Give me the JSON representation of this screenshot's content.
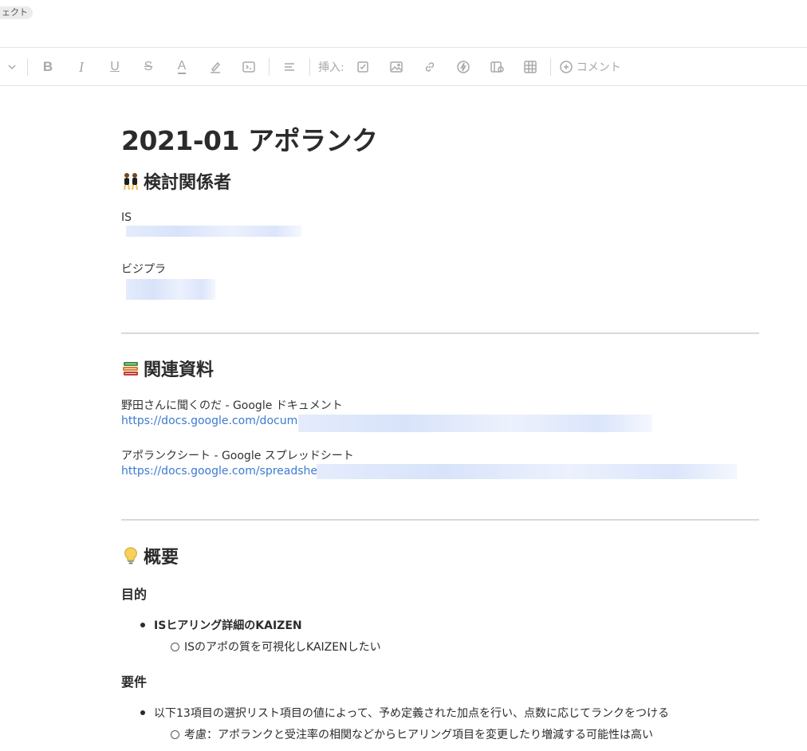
{
  "header": {
    "tag_label": "ェクト"
  },
  "toolbar": {
    "bold": "B",
    "italic": "I",
    "underline": "U",
    "strike": "S",
    "text_color": "A",
    "insert_label": "挿入:",
    "comment_label": "コメント",
    "icons": [
      "chevron-down-icon",
      "bold-icon",
      "italic-icon",
      "underline-icon",
      "strikethrough-icon",
      "text-color-icon",
      "highlight-icon",
      "code-icon",
      "align-icon",
      "checkbox-icon",
      "image-icon",
      "link-icon",
      "lightning-icon",
      "embed-icon",
      "table-icon",
      "add-comment-icon"
    ]
  },
  "doc": {
    "title": "2021-01 アポランク",
    "stakeholders": {
      "heading": "検討関係者",
      "emoji": "dancers-emoji",
      "groups": [
        {
          "label": "IS"
        },
        {
          "label": "ビジプラ"
        }
      ]
    },
    "materials": {
      "heading": "関連資料",
      "emoji": "books-emoji",
      "items": [
        {
          "title": "野田さんに聞くのだ - Google ドキュメント",
          "url": "https://docs.google.com/documen"
        },
        {
          "title": "アポランクシート - Google スプレッドシート",
          "url": "https://docs.google.com/spreadsheets"
        }
      ]
    },
    "overview": {
      "heading": "概要",
      "emoji": "lightbulb-emoji",
      "purpose": {
        "heading": "目的",
        "bullet": "ISヒアリング詳細のKAIZEN",
        "sub": "ISのアポの質を可視化しKAIZENしたい"
      },
      "requirements": {
        "heading": "要件",
        "bullet": "以下13項目の選択リスト項目の値によって、予め定義された加点を行い、点数に応じてランクをつける",
        "sub": "考慮：アポランクと受注率の相関などからヒアリング項目を変更したり増減する可能性は高い"
      }
    }
  },
  "colors": {
    "link": "#3b7bd0",
    "text": "#333333",
    "toolbar_icon": "#a8a8a8",
    "divider": "#d9d9d9"
  }
}
